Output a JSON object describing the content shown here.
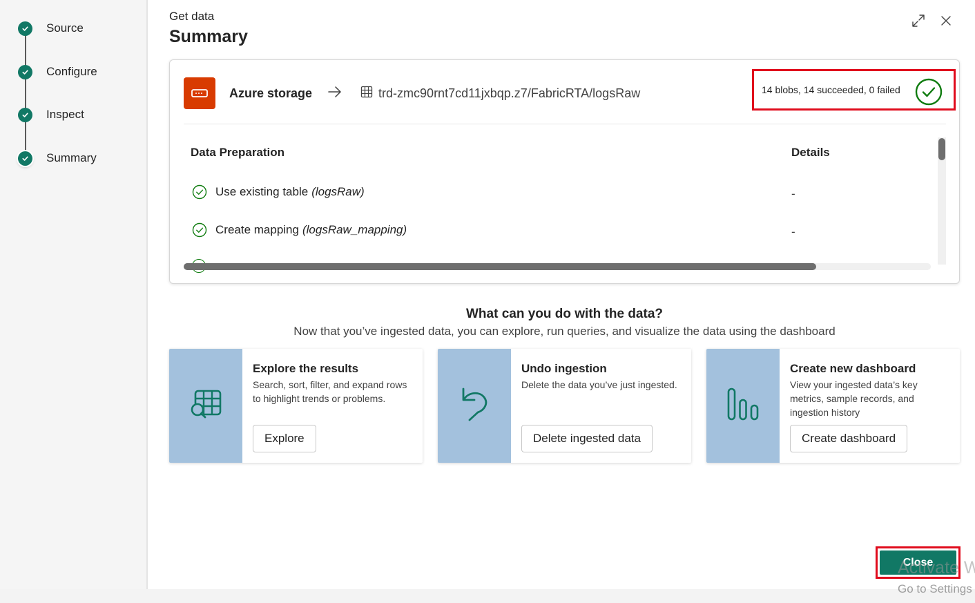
{
  "sidebar": {
    "steps": [
      {
        "label": "Source",
        "done": true
      },
      {
        "label": "Configure",
        "done": true
      },
      {
        "label": "Inspect",
        "done": true
      },
      {
        "label": "Summary",
        "done": true,
        "active": true
      }
    ]
  },
  "header": {
    "small_title": "Get data",
    "title": "Summary",
    "icons": [
      "expand-icon",
      "close-icon"
    ]
  },
  "summary": {
    "source_name": "Azure storage",
    "destination_path": "trd-zmc90rnt7cd11jxbqp.z7/FabricRTA/logsRaw",
    "status": "14 blobs, 14 succeeded, 0 failed",
    "columns": {
      "prep": "Data Preparation",
      "details": "Details"
    },
    "rows": [
      {
        "action": "Use existing table",
        "target": "(logsRaw)",
        "details": "-"
      },
      {
        "action": "Create mapping",
        "target": "(logsRaw_mapping)",
        "details": "-"
      }
    ]
  },
  "next": {
    "title": "What can you do with the data?",
    "subtitle": "Now that you’ve ingested data, you can explore, run queries, and visualize the data using the dashboard",
    "cards": [
      {
        "title": "Explore the results",
        "desc": "Search, sort, filter, and expand rows to highlight trends or problems.",
        "button": "Explore",
        "icon": "table-search-icon"
      },
      {
        "title": "Undo ingestion",
        "desc": "Delete the data you’ve just ingested.",
        "button": "Delete ingested data",
        "icon": "undo-icon"
      },
      {
        "title": "Create new dashboard",
        "desc": "View your ingested data’s key metrics, sample records, and ingestion history",
        "button": "Create dashboard",
        "icon": "bar-chart-icon"
      }
    ]
  },
  "footer": {
    "close_label": "Close",
    "watermark_line1": "Activate W",
    "watermark_line2": "Go to Settings"
  },
  "colors": {
    "accent": "#117865",
    "highlight": "#e00b1c",
    "source_icon": "#d83b01",
    "card_art": "#a3c1dd",
    "success": "#107c10"
  }
}
